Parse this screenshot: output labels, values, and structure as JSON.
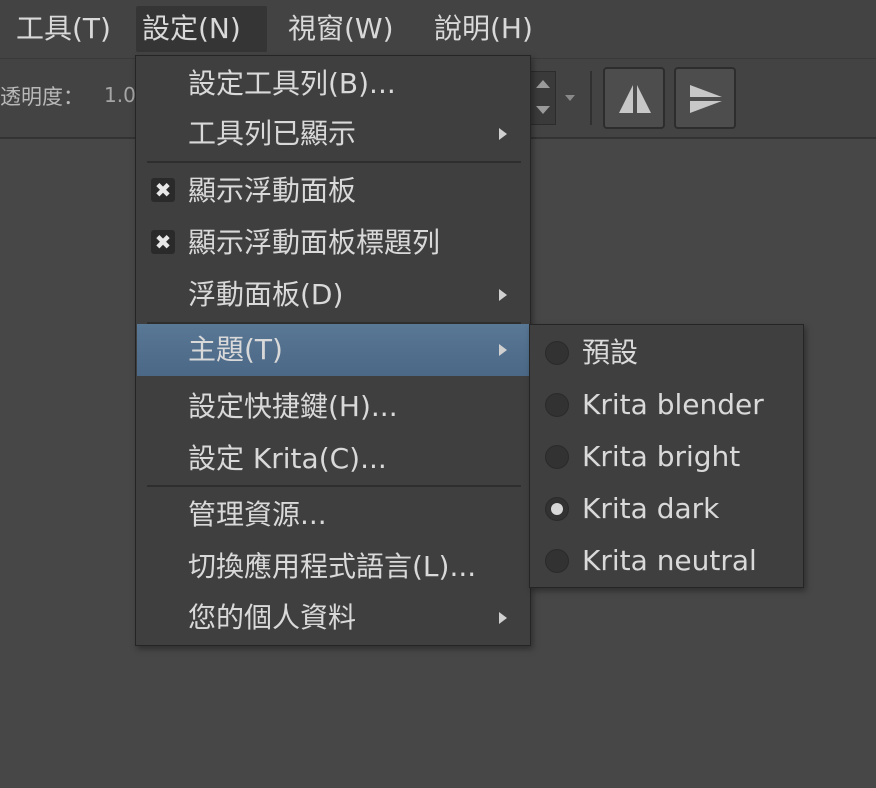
{
  "menubar": {
    "items": [
      {
        "label": "工具(T)"
      },
      {
        "label": "設定(N)"
      },
      {
        "label": "視窗(W)"
      },
      {
        "label": "說明(H)"
      }
    ]
  },
  "toolbar": {
    "opacity_label": "透明度：",
    "opacity_value": "1.0"
  },
  "settings_menu": {
    "items": [
      {
        "label": "設定工具列(B)..."
      },
      {
        "label": "工具列已顯示"
      },
      {
        "label": "顯示浮動面板",
        "checked": true
      },
      {
        "label": "顯示浮動面板標題列",
        "checked": true
      },
      {
        "label": "浮動面板(D)"
      },
      {
        "label": "主題(T)"
      },
      {
        "label": "設定快捷鍵(H)..."
      },
      {
        "label": "設定 Krita(C)..."
      },
      {
        "label": "管理資源..."
      },
      {
        "label": "切換應用程式語言(L)..."
      },
      {
        "label": "您的個人資料"
      }
    ],
    "check_glyph": "✖",
    "highlight_color": "#5a7896"
  },
  "theme_submenu": {
    "items": [
      {
        "label": "預設"
      },
      {
        "label": "Krita blender"
      },
      {
        "label": "Krita bright"
      },
      {
        "label": "Krita dark",
        "selected": true
      },
      {
        "label": "Krita neutral"
      }
    ]
  }
}
